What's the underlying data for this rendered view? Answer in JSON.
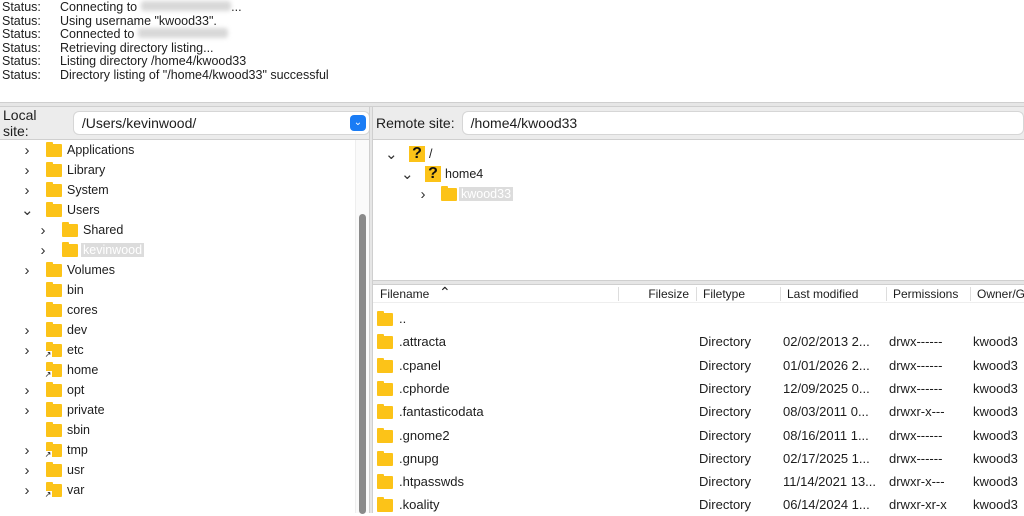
{
  "log": [
    {
      "label": "Status:",
      "text": "Connecting to",
      "suffix": "...",
      "redacted": true
    },
    {
      "label": "Status:",
      "text": "Using username \"kwood33\".",
      "redacted": false
    },
    {
      "label": "Status:",
      "text": "Connected to",
      "suffix": "",
      "redacted": true
    },
    {
      "label": "Status:",
      "text": "Retrieving directory listing...",
      "redacted": false
    },
    {
      "label": "Status:",
      "text": "Listing directory /home4/kwood33",
      "redacted": false
    },
    {
      "label": "Status:",
      "text": "Directory listing of \"/home4/kwood33\" successful",
      "redacted": false
    }
  ],
  "local": {
    "label": "Local site:",
    "path": "/Users/kevinwood/",
    "tree": [
      {
        "name": "Applications",
        "level": 1,
        "chev": ">"
      },
      {
        "name": "Library",
        "level": 1,
        "chev": ">"
      },
      {
        "name": "System",
        "level": 1,
        "chev": ">"
      },
      {
        "name": "Users",
        "level": 1,
        "chev": "v"
      },
      {
        "name": "Shared",
        "level": 2,
        "chev": ">"
      },
      {
        "name": "kevinwood",
        "level": 2,
        "chev": ">",
        "selected": true
      },
      {
        "name": "Volumes",
        "level": 1,
        "chev": ">"
      },
      {
        "name": "bin",
        "level": 1,
        "chev": ""
      },
      {
        "name": "cores",
        "level": 1,
        "chev": ""
      },
      {
        "name": "dev",
        "level": 1,
        "chev": ">"
      },
      {
        "name": "etc",
        "level": 1,
        "chev": ">",
        "link": true
      },
      {
        "name": "home",
        "level": 1,
        "chev": "",
        "link": true
      },
      {
        "name": "opt",
        "level": 1,
        "chev": ">"
      },
      {
        "name": "private",
        "level": 1,
        "chev": ">"
      },
      {
        "name": "sbin",
        "level": 1,
        "chev": ""
      },
      {
        "name": "tmp",
        "level": 1,
        "chev": ">",
        "link": true
      },
      {
        "name": "usr",
        "level": 1,
        "chev": ">"
      },
      {
        "name": "var",
        "level": 1,
        "chev": ">",
        "link": true
      }
    ]
  },
  "remote": {
    "label": "Remote site:",
    "path": "/home4/kwood33",
    "tree": [
      {
        "name": "/",
        "level": 0,
        "chev": "v",
        "icon": "unknown"
      },
      {
        "name": "home4",
        "level": 1,
        "chev": "v",
        "icon": "unknown"
      },
      {
        "name": "kwood33",
        "level": 2,
        "chev": ">",
        "icon": "folder",
        "selected": true
      }
    ],
    "columns": [
      "Filename",
      "Filesize",
      "Filetype",
      "Last modified",
      "Permissions",
      "Owner/G"
    ],
    "sort": "Filename ascending",
    "files": [
      {
        "name": "..",
        "size": "",
        "type": "",
        "modified": "",
        "perms": "",
        "owner": ""
      },
      {
        "name": ".attracta",
        "size": "",
        "type": "Directory",
        "modified": "02/02/2013 2...",
        "perms": "drwx------",
        "owner": "kwood3"
      },
      {
        "name": ".cpanel",
        "size": "",
        "type": "Directory",
        "modified": "01/01/2026 2...",
        "perms": "drwx------",
        "owner": "kwood3"
      },
      {
        "name": ".cphorde",
        "size": "",
        "type": "Directory",
        "modified": "12/09/2025 0...",
        "perms": "drwx------",
        "owner": "kwood3"
      },
      {
        "name": ".fantasticodata",
        "size": "",
        "type": "Directory",
        "modified": "08/03/2011 0...",
        "perms": "drwxr-x---",
        "owner": "kwood3"
      },
      {
        "name": ".gnome2",
        "size": "",
        "type": "Directory",
        "modified": "08/16/2011 1...",
        "perms": "drwx------",
        "owner": "kwood3"
      },
      {
        "name": ".gnupg",
        "size": "",
        "type": "Directory",
        "modified": "02/17/2025 1...",
        "perms": "drwx------",
        "owner": "kwood3"
      },
      {
        "name": ".htpasswds",
        "size": "",
        "type": "Directory",
        "modified": "11/14/2021 13...",
        "perms": "drwxr-x---",
        "owner": "kwood3"
      },
      {
        "name": ".koality",
        "size": "",
        "type": "Directory",
        "modified": "06/14/2024 1...",
        "perms": "drwxr-xr-x",
        "owner": "kwood3"
      }
    ]
  },
  "colors": {
    "folder": "#fcc318",
    "accent": "#1a7cf5"
  }
}
